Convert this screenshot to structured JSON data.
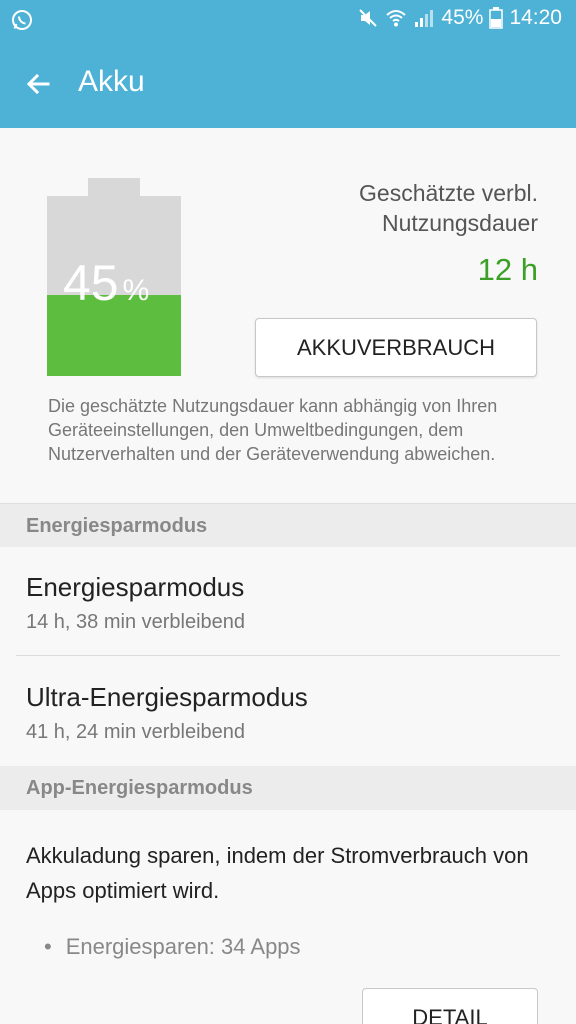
{
  "status_bar": {
    "battery_percent": "45%",
    "time": "14:20",
    "icons": [
      "whatsapp-icon",
      "mute-icon",
      "wifi-icon",
      "signal-icon",
      "battery-icon"
    ]
  },
  "app_bar": {
    "title": "Akku",
    "back_icon": "arrow-back-icon"
  },
  "battery": {
    "level_value": 0.45,
    "level_text": "45",
    "unit": "%",
    "estimate_label": "Geschätzte verbl. Nutzungsdauer",
    "estimate_value": "12 h",
    "usage_button": "AKKUVERBRAUCH",
    "disclaimer": "Die geschätzte Nutzungsdauer kann abhängig von Ihren Geräteeinstellungen, den Umweltbedingungen, dem Nutzerverhalten und der Geräteverwendung abweichen."
  },
  "sections": {
    "power_saving": {
      "header": "Energiesparmodus",
      "items": [
        {
          "title": "Energiesparmodus",
          "subtitle": "14 h, 38 min verbleibend"
        },
        {
          "title": "Ultra-Energiesparmodus",
          "subtitle": "41 h, 24 min verbleibend"
        }
      ]
    },
    "app_power_saving": {
      "header": "App-Energiesparmodus",
      "description": "Akkuladung sparen, indem der Stromverbrauch von Apps optimiert wird.",
      "bullet": "Energiesparen: 34 Apps",
      "detail_button": "DETAIL"
    }
  },
  "colors": {
    "app_bar": "#4db2d6",
    "battery_fill": "#5cbd3e",
    "battery_empty": "#d8d8d8",
    "estimate_value": "#3ca026"
  }
}
